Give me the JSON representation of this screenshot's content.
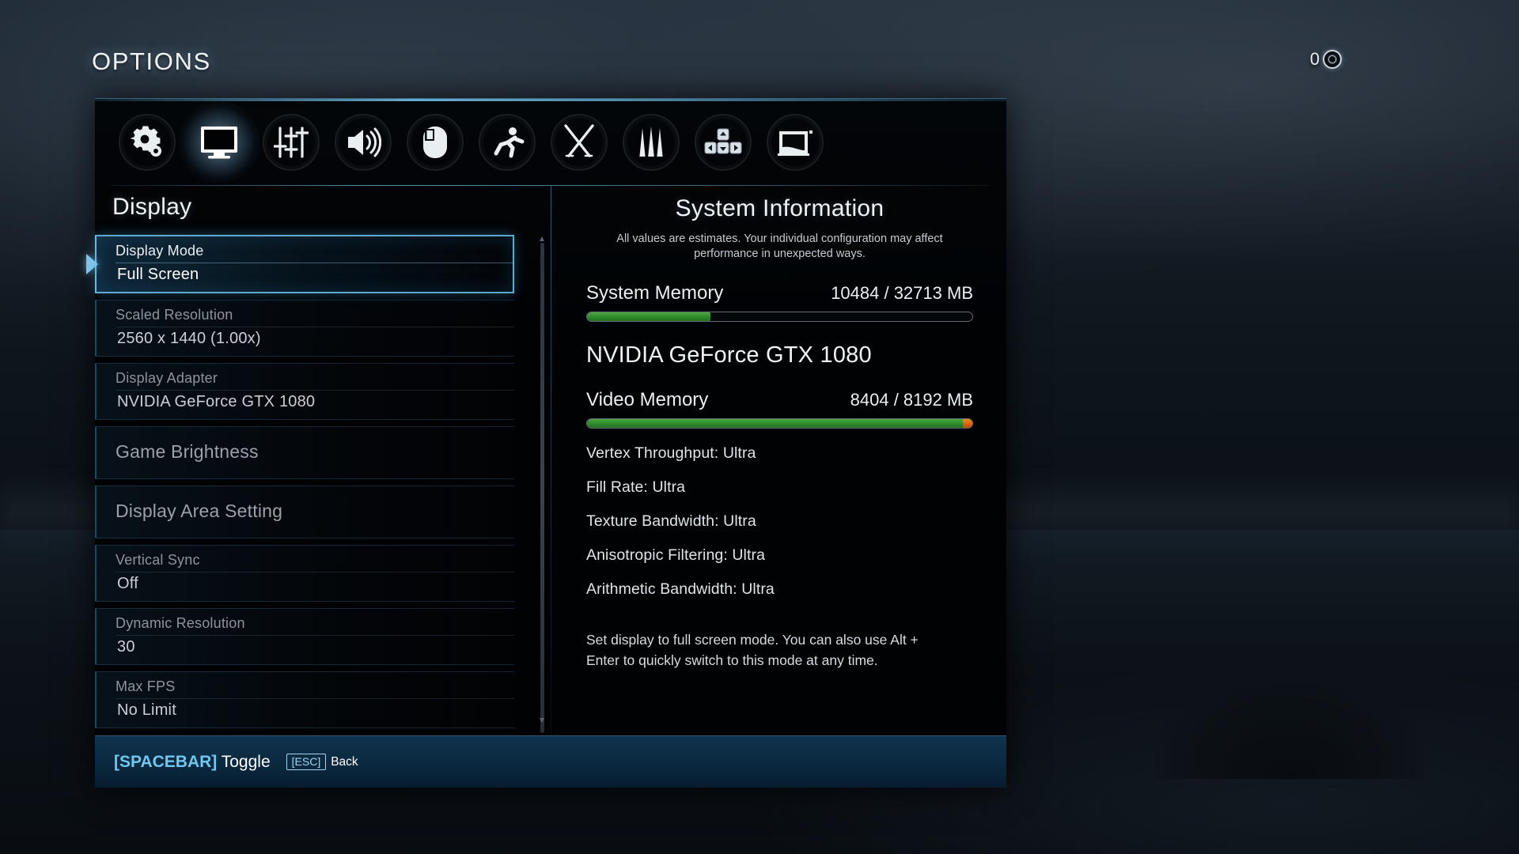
{
  "screen": {
    "title": "OPTIONS",
    "counter_value": "0",
    "counter_icon": "ring-coin-icon"
  },
  "tabs": [
    {
      "name": "gameplay",
      "icon": "gear-icon",
      "selected": false
    },
    {
      "name": "display",
      "icon": "monitor-icon",
      "selected": true
    },
    {
      "name": "graphics",
      "icon": "sliders-icon",
      "selected": false
    },
    {
      "name": "audio",
      "icon": "speaker-icon",
      "selected": false
    },
    {
      "name": "mouse",
      "icon": "mouse-icon",
      "selected": false
    },
    {
      "name": "movement",
      "icon": "runner-icon",
      "selected": false
    },
    {
      "name": "combat",
      "icon": "crossed-swords-icon",
      "selected": false
    },
    {
      "name": "magic",
      "icon": "spikes-icon",
      "selected": false
    },
    {
      "name": "keybinds",
      "icon": "arrow-keys-icon",
      "selected": false
    },
    {
      "name": "interface",
      "icon": "screen-area-icon",
      "selected": false
    }
  ],
  "left": {
    "section_title": "Display",
    "rows": [
      {
        "label": "Display Mode",
        "value": "Full Screen",
        "selected": true,
        "single": false
      },
      {
        "label": "Scaled Resolution",
        "value": "2560 x 1440 (1.00x)",
        "selected": false,
        "single": false
      },
      {
        "label": "Display Adapter",
        "value": "NVIDIA GeForce GTX 1080",
        "selected": false,
        "single": false
      },
      {
        "label": "Game Brightness",
        "value": "",
        "selected": false,
        "single": true
      },
      {
        "label": "Display Area Setting",
        "value": "",
        "selected": false,
        "single": true
      },
      {
        "label": "Vertical Sync",
        "value": "Off",
        "selected": false,
        "single": false
      },
      {
        "label": "Dynamic Resolution",
        "value": "30",
        "selected": false,
        "single": false
      },
      {
        "label": "Max FPS",
        "value": "No Limit",
        "selected": false,
        "single": false
      }
    ]
  },
  "right": {
    "title": "System Information",
    "note": "All values are estimates. Your individual configuration may affect performance in unexpected ways.",
    "system_memory": {
      "label": "System Memory",
      "value": "10484 / 32713 MB",
      "used_mb": 10484,
      "total_mb": 32713,
      "percent": 32,
      "bar_color": "#3b8f32"
    },
    "gpu_name": "NVIDIA GeForce GTX 1080",
    "video_memory": {
      "label": "Video Memory",
      "value": "8404 / 8192 MB",
      "used_mb": 8404,
      "total_mb": 8192,
      "percent": 100,
      "bar_color": "#3b8f32",
      "over_color": "#e0700f"
    },
    "gpu_stats": [
      "Vertex Throughput: Ultra",
      "Fill Rate: Ultra",
      "Texture Bandwidth: Ultra",
      "Anisotropic Filtering: Ultra",
      "Arithmetic Bandwidth: Ultra"
    ],
    "description": "Set display to full screen mode. You can also use Alt + Enter to quickly switch to this mode at any time."
  },
  "footer": {
    "toggle_key": "[SPACEBAR]",
    "toggle_label": "Toggle",
    "back_key": "[ESC]",
    "back_label": "Back"
  },
  "colors": {
    "accent": "#6fc8f0",
    "panel_border": "#3d7da5",
    "bar_green": "#3b8f32",
    "bar_orange": "#e0700f"
  }
}
